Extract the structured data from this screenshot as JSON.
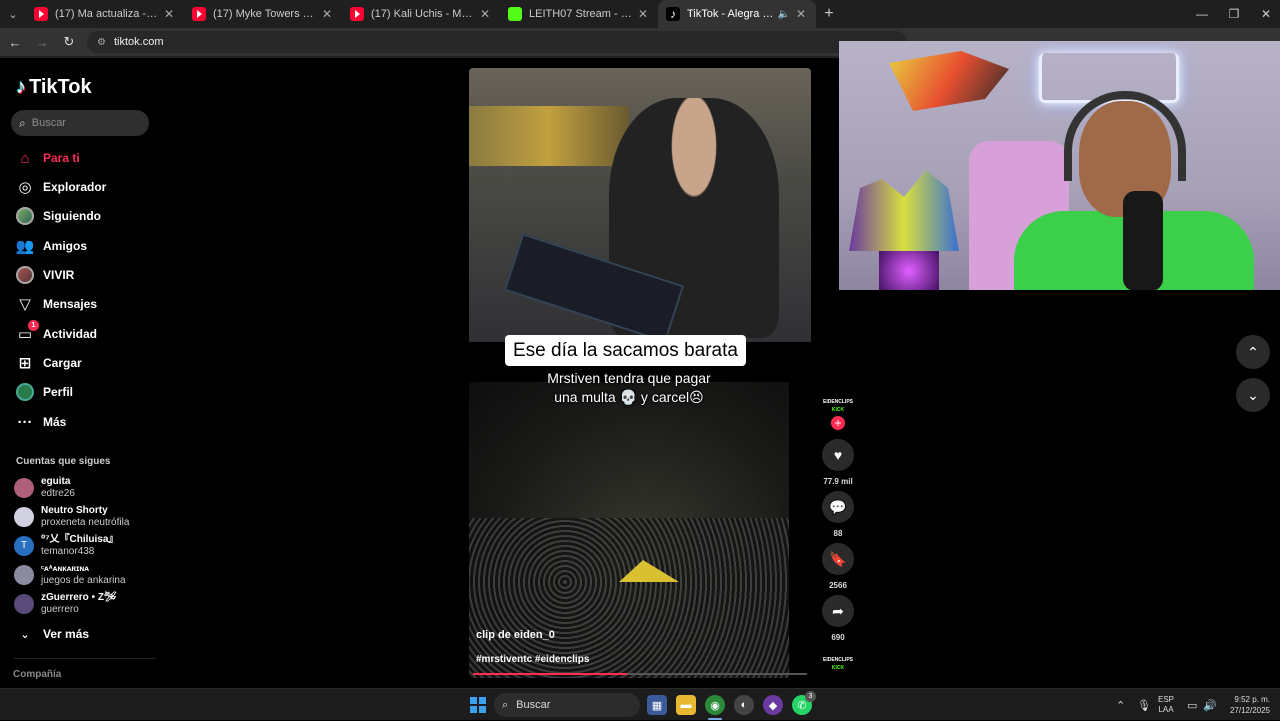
{
  "browser": {
    "tabs": [
      {
        "label": "(17) Ma actualiza - YouTube",
        "icon": "youtube-icon"
      },
      {
        "label": "(17) Myke Towers - LO LOGRÉ (",
        "icon": "youtube-icon"
      },
      {
        "label": "(17) Kali Uchis - Muévelo (Letra",
        "icon": "youtube-icon"
      },
      {
        "label": "LEITH07 Stream - Watch Live o",
        "icon": "kick-icon"
      },
      {
        "label": "TikTok - Alegra tu día",
        "icon": "tiktok-icon",
        "active": true
      }
    ],
    "url": "tiktok.com"
  },
  "sidebar": {
    "logo_text": "TikTok",
    "search_placeholder": "Buscar",
    "nav": [
      {
        "label": "Para ti",
        "icon": "home-icon",
        "active": true
      },
      {
        "label": "Explorador",
        "icon": "compass-icon"
      },
      {
        "label": "Siguiendo",
        "icon": "following-avatar-icon"
      },
      {
        "label": "Amigos",
        "icon": "friends-icon"
      },
      {
        "label": "VIVIR",
        "icon": "live-icon"
      },
      {
        "label": "Mensajes",
        "icon": "messages-icon"
      },
      {
        "label": "Actividad",
        "icon": "activity-icon",
        "badge": "1"
      },
      {
        "label": "Cargar",
        "icon": "upload-icon"
      },
      {
        "label": "Perfil",
        "icon": "profile-icon"
      },
      {
        "label": "Más",
        "icon": "more-icon"
      }
    ],
    "following_title": "Cuentas que sigues",
    "following": [
      {
        "name": "eguita",
        "handle": "edtre26",
        "color": "#b0607a"
      },
      {
        "name": "Neutro Shorty",
        "handle": "proxeneta neutrófila",
        "color": "#d0d0e0"
      },
      {
        "name": "⁰⁷乂『Chiluisa』",
        "handle": "temanor438",
        "color": "#2a70c0",
        "initial": "T"
      },
      {
        "name": "ᶜᴀᴬᴀɴᴋᴀʀɪɴᴀ",
        "handle": "juegos de ankarina",
        "color": "#8a8aa0"
      },
      {
        "name": "zGuerrero • Z🛩",
        "handle": "guerrero",
        "color": "#5a4a7a"
      }
    ],
    "see_more": "Ver más",
    "company": "Compañía"
  },
  "video": {
    "caption_title": "Ese día la sacamos barata",
    "caption_line1": "Mrstiven tendra que pagar",
    "caption_line2": "una multa 💀 y carcel😣",
    "credit": "clip de eiden_0",
    "hashtags": "#mrstiventc #eidenclips",
    "progress": 0.46,
    "creator_logo_top": "EIDENCLIPS",
    "creator_logo_bottom": "KICK"
  },
  "actions": {
    "likes": "77.9 mil",
    "comments": "88",
    "saves": "2566",
    "shares": "690"
  },
  "taskbar": {
    "search": "Buscar",
    "lang_top": "ESP",
    "lang_bottom": "LAA",
    "time": "9:52 p. m.",
    "date": "27/12/2025",
    "whatsapp_badge": "3"
  },
  "colors": {
    "accent": "#fe2c55",
    "kick_green": "#53fc18"
  }
}
